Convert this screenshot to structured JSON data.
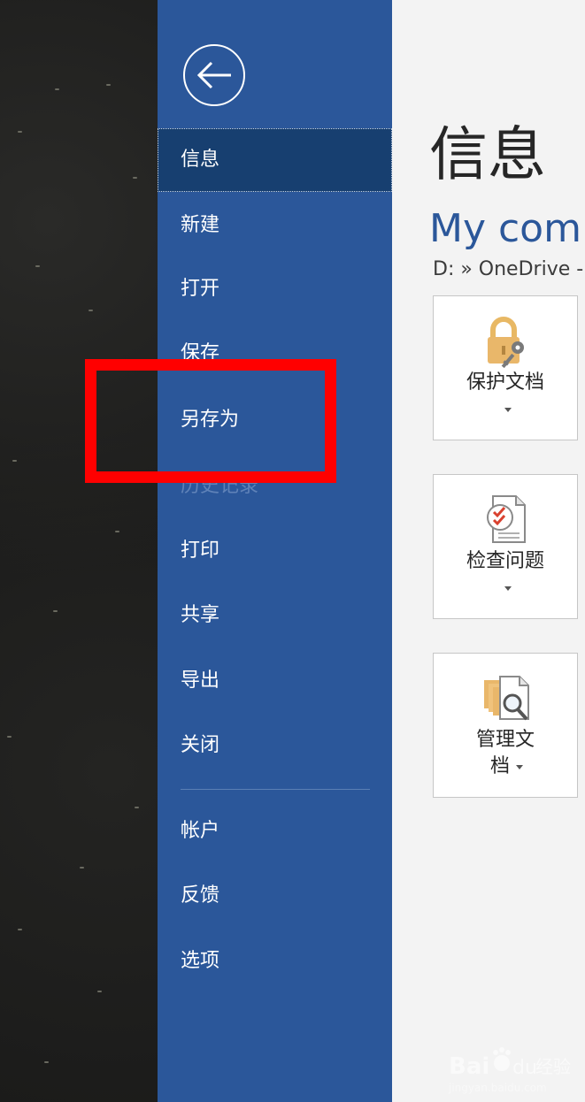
{
  "sidebar": {
    "back_icon": "back-arrow-icon",
    "items": [
      {
        "label": "信息",
        "selected": true,
        "disabled": false
      },
      {
        "label": "新建",
        "selected": false,
        "disabled": false
      },
      {
        "label": "打开",
        "selected": false,
        "disabled": false
      },
      {
        "label": "保存",
        "selected": false,
        "disabled": false
      },
      {
        "label": "另存为",
        "selected": false,
        "disabled": false
      },
      {
        "label": "历史记录",
        "selected": false,
        "disabled": true
      },
      {
        "label": "打印",
        "selected": false,
        "disabled": false
      },
      {
        "label": "共享",
        "selected": false,
        "disabled": false
      },
      {
        "label": "导出",
        "selected": false,
        "disabled": false
      },
      {
        "label": "关闭",
        "selected": false,
        "disabled": false
      }
    ],
    "bottom_items": [
      {
        "label": "帐户"
      },
      {
        "label": "反馈"
      },
      {
        "label": "选项"
      }
    ]
  },
  "main": {
    "page_title": "信息",
    "doc_title": "My comm",
    "doc_path": "D: » OneDrive -",
    "tiles": [
      {
        "label": "保护文档",
        "icon": "lock-key-icon"
      },
      {
        "label": "检查问题",
        "icon": "document-checklist-icon"
      },
      {
        "label_line1": "管理文",
        "label_line2": "档",
        "icon": "documents-magnifier-icon"
      }
    ]
  },
  "annotation": {
    "color": "#ff0000",
    "target": "另存为"
  },
  "watermark": {
    "brand": "Bai",
    "brand_suffix": "du",
    "product": "经验",
    "url": "jingyan.baidu.com"
  },
  "colors": {
    "sidebar_bg": "#2b579a",
    "sidebar_selected": "#173f70",
    "content_bg": "#f3f3f3",
    "title_blue": "#2b579a"
  }
}
